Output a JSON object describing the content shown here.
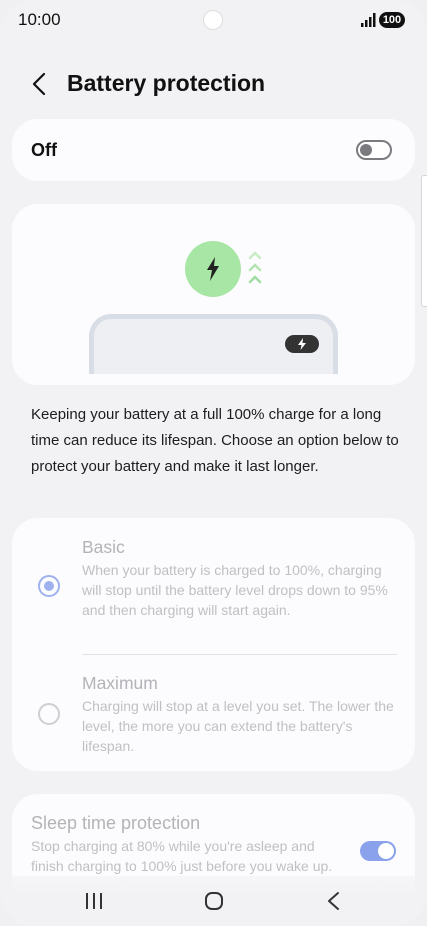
{
  "status_bar": {
    "time": "10:00",
    "battery": "100"
  },
  "header": {
    "title": "Battery protection"
  },
  "master_toggle": {
    "label": "Off",
    "state": "off"
  },
  "description": "Keeping your battery at a full 100% charge for a long time can reduce its lifespan. Choose an option below to protect your battery and make it last longer.",
  "options": [
    {
      "title": "Basic",
      "description": "When your battery is charged to 100%, charging will stop until the battery level drops down to 95% and then charging will start again.",
      "selected": true
    },
    {
      "title": "Maximum",
      "description": "Charging will stop at a level you set. The lower the level, the more you can extend the battery's lifespan.",
      "selected": false
    }
  ],
  "sleep_protection": {
    "title": "Sleep time protection",
    "description": "Stop charging at 80% while you're asleep and finish charging to 100% just before you wake up.",
    "state": "on"
  },
  "colors": {
    "accent": "#8aa2ec",
    "bolt_green": "#a8e6a6",
    "background": "#f2f2f4",
    "card": "#fcfcfe"
  },
  "icons": [
    "back-icon",
    "bolt-icon",
    "signal-icon",
    "recents-icon",
    "home-icon",
    "nav-back-icon"
  ]
}
